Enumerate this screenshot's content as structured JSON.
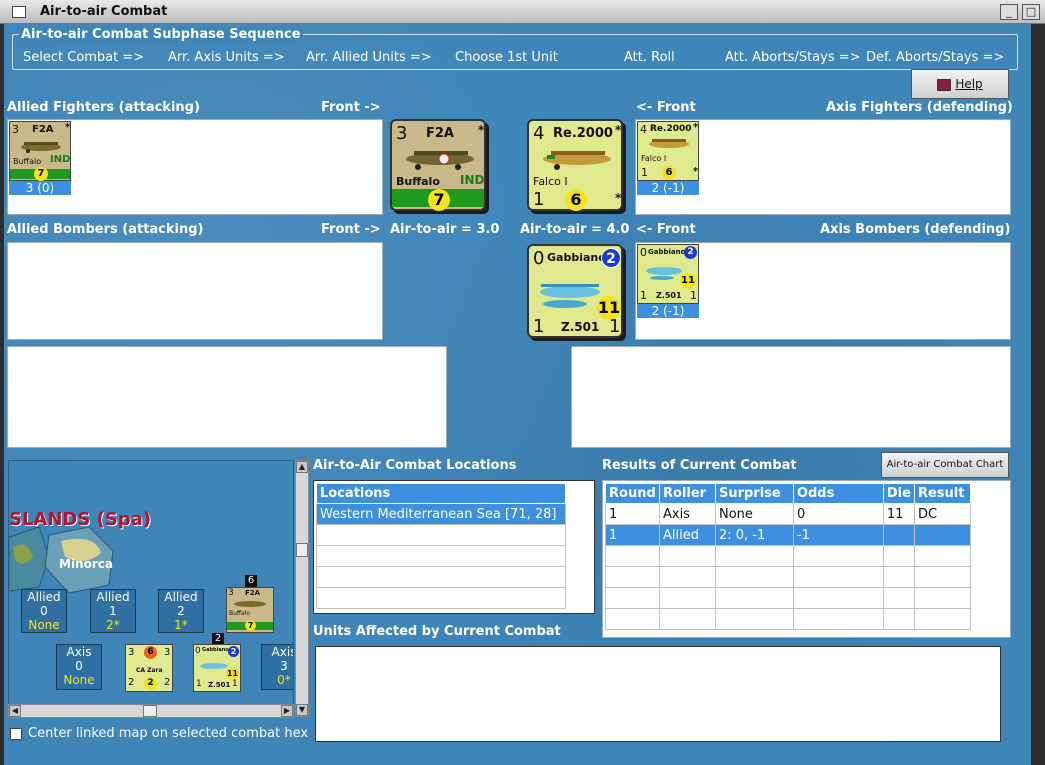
{
  "window": {
    "title": "Air-to-air Combat"
  },
  "sequence": {
    "legend": "Air-to-air Combat Subphase Sequence",
    "steps": [
      "Select Combat =>",
      "Arr. Axis Units =>",
      "Arr. Allied Units =>",
      "Choose 1st Unit",
      "Att. Roll",
      "Att. Aborts/Stays =>",
      "Def. Aborts/Stays =>"
    ]
  },
  "help_button": {
    "label": "Help"
  },
  "allied_fighters": {
    "label": "Allied Fighters (attacking)",
    "front": "Front ->",
    "unit": {
      "top_left": "3",
      "name": "F2A",
      "star": "*",
      "model": "Buffalo",
      "nat": "IND",
      "rating": "7",
      "stat": "3 (0)"
    }
  },
  "axis_fighters": {
    "label": "Axis Fighters (defending)",
    "front": "<- Front",
    "unit": {
      "top_left": "4",
      "name": "Re.2000",
      "star": "*",
      "model": "Falco I",
      "bottom_left": "1",
      "rating": "6",
      "stat": "2 (-1)"
    }
  },
  "allied_bombers": {
    "label": "Allied Bombers (attacking)",
    "front": "Front ->"
  },
  "axis_bombers": {
    "label": "Axis Bombers (defending)",
    "front": "<- Front",
    "unit": {
      "top_left": "0",
      "name": "Gabbiano",
      "badge": "2",
      "rating": "11",
      "bottom_left": "1",
      "model": "Z.501",
      "bottom_right": "1",
      "stat": "2 (-1)"
    }
  },
  "big_allied_fighter": {
    "top_left": "3",
    "name": "F2A",
    "star": "*",
    "model": "Buffalo",
    "nat": "IND",
    "rating": "7",
    "air_to_air": "Air-to-air = 3.0"
  },
  "big_axis_fighter": {
    "top_left": "4",
    "name": "Re.2000",
    "star": "*",
    "model": "Falco I",
    "bottom_left": "1",
    "rating": "6",
    "air_to_air": "Air-to-air = 4.0"
  },
  "big_axis_bomber": {
    "top_left": "0",
    "name": "Gabbiano",
    "badge": "2",
    "rating": "11",
    "bottom_left": "1",
    "model": "Z.501",
    "bottom_right": "1"
  },
  "locations": {
    "label": "Air-to-Air Combat Locations",
    "header": "Locations",
    "rows": [
      "Western Mediterranean Sea [71, 28]",
      "",
      "",
      "",
      ""
    ]
  },
  "results": {
    "label": "Results of Current Combat",
    "chart_button": "Air-to-air Combat Chart",
    "headers": [
      "Round",
      "Roller",
      "Surprise",
      "Odds",
      "Die",
      "Result"
    ],
    "rows": [
      [
        "1",
        "Axis",
        "None",
        "0",
        "11",
        "DC"
      ],
      [
        "1",
        "Allied",
        "2: 0, -1",
        "-1",
        "",
        ""
      ],
      [
        "",
        "",
        "",
        "",
        "",
        ""
      ],
      [
        "",
        "",
        "",
        "",
        "",
        ""
      ],
      [
        "",
        "",
        "",
        "",
        "",
        ""
      ],
      [
        "",
        "",
        "",
        "",
        "",
        ""
      ]
    ]
  },
  "units_affected": {
    "label": "Units Affected by Current Combat"
  },
  "map": {
    "region": "SLANDS (Spa)",
    "hex_label": "Minorca",
    "allied_boxes": [
      {
        "title": "Allied",
        "num": "0",
        "sub": "None"
      },
      {
        "title": "Allied",
        "num": "1",
        "sub": "2*"
      },
      {
        "title": "Allied",
        "num": "2",
        "sub": "1*"
      }
    ],
    "axis_boxes": [
      {
        "title": "Axis",
        "num": "0",
        "sub": "None"
      },
      {
        "title": "Axis",
        "num": "3",
        "sub": "0*"
      }
    ],
    "stack_counts": [
      "6",
      "2"
    ],
    "mini_f2a": {
      "tl": "3",
      "name": "F2A",
      "model": "Buffalo",
      "rating": "7"
    },
    "mini_zara": {
      "tl": "3",
      "badge": "6",
      "tr": "3",
      "name": "CA Zara",
      "bl": "2",
      "rating": "2",
      "br": "2"
    },
    "mini_gab": {
      "tl": "0",
      "name": "Gabbiano",
      "badge": "2",
      "rating": "11",
      "bl": "1",
      "model": "Z.501",
      "br": "1"
    }
  },
  "center_checkbox": {
    "label": "Center linked map on selected combat hex"
  }
}
